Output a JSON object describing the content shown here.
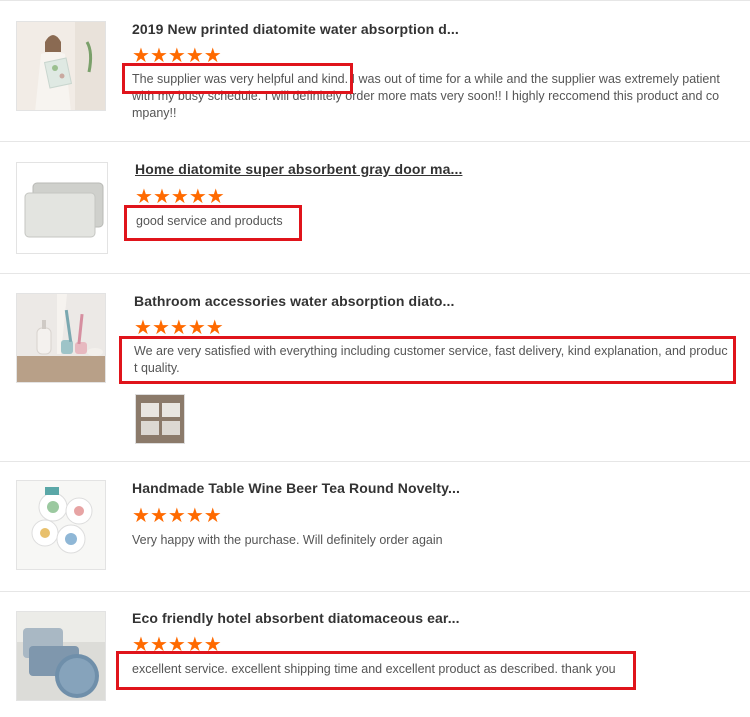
{
  "reviews": [
    {
      "product_title": "2019 New printed diatomite water absorption d...",
      "rating": 5,
      "star_glyph": "★",
      "text": "The supplier was very helpful and kind. I was out of time for a while and the supplier was extremely patient with my busy schedule. I will definitely order more mats very soon!! I highly reccomend this product and co mpany!!",
      "thumb_icon": "woman-holding-mat-photo"
    },
    {
      "product_title": "Home diatomite super absorbent gray door ma...",
      "rating": 5,
      "star_glyph": "★",
      "text": "good service and products",
      "thumb_icon": "gray-bath-mat-photo"
    },
    {
      "product_title": "Bathroom accessories water absorption diato...",
      "rating": 5,
      "star_glyph": "★",
      "text": "We are very satisfied with everything including customer service, fast delivery, kind explanation, and produc t quality.",
      "thumb_icon": "bathroom-accessories-photo",
      "attachment_icon": "buyer-photo-boxes"
    },
    {
      "product_title": "Handmade Table Wine Beer Tea Round Novelty...",
      "rating": 5,
      "star_glyph": "★",
      "text": "Very happy with the purchase. Will definitely order again",
      "thumb_icon": "round-coasters-photo"
    },
    {
      "product_title": "Eco friendly hotel absorbent diatomaceous ear...",
      "rating": 5,
      "star_glyph": "★",
      "text": "excellent service. excellent shipping time and excellent product as described. thank you",
      "thumb_icon": "blue-diatomite-coasters-photo"
    }
  ],
  "colors": {
    "star": "#ff6a00",
    "highlight": "#e0141b",
    "divider": "#e6e6e6"
  }
}
